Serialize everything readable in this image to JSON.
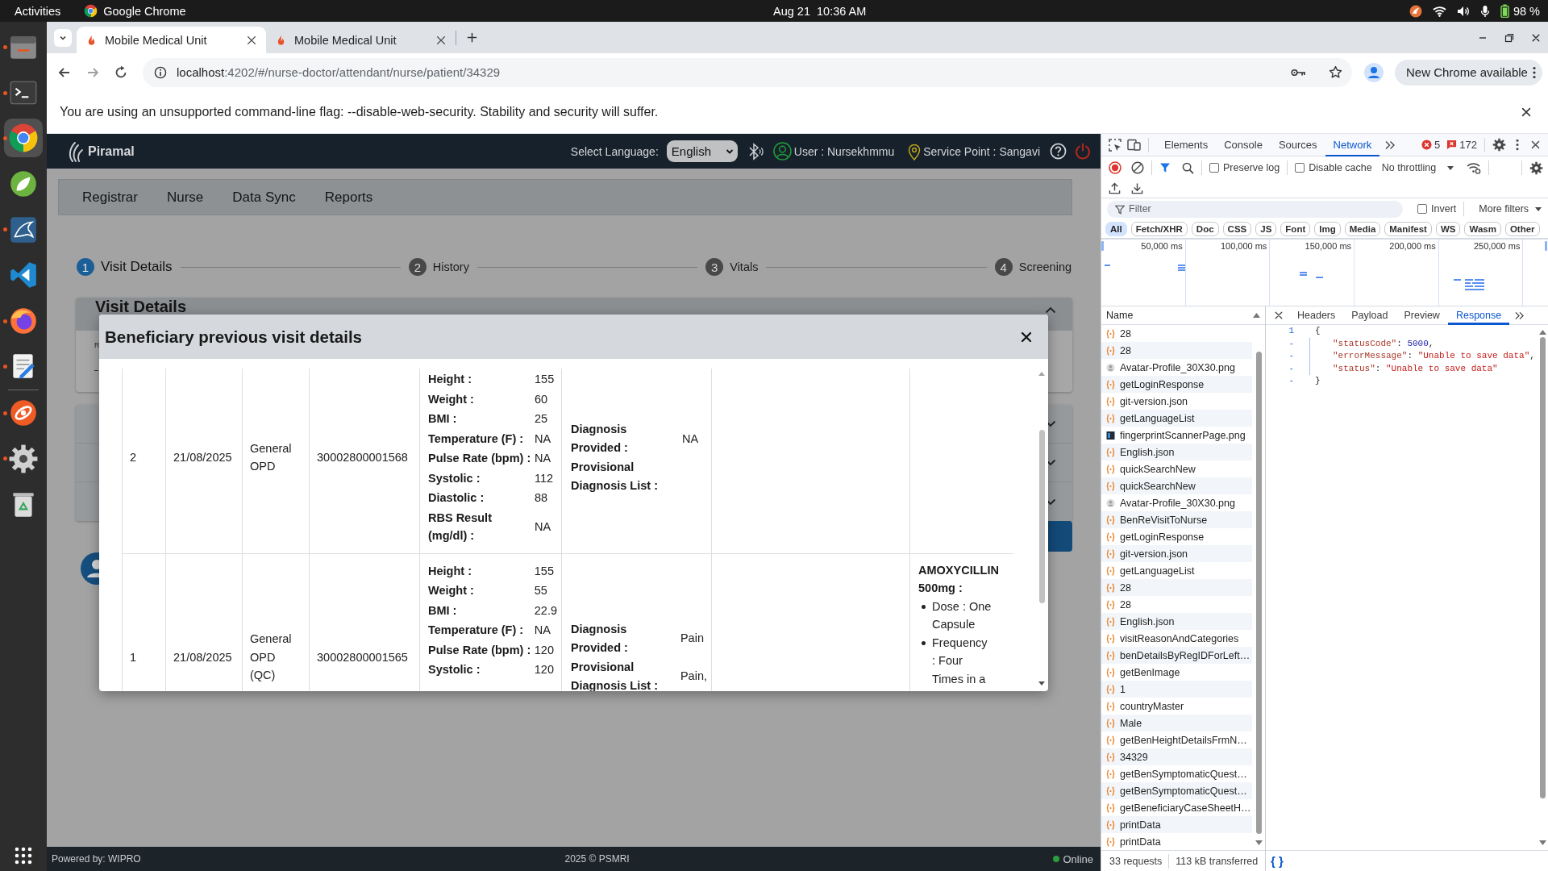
{
  "topbar": {
    "activities": "Activities",
    "app": "Google Chrome",
    "clock": "Aug 21  10:36 AM",
    "battery": "98 %"
  },
  "dock": [
    {
      "kind": "folder",
      "running": true,
      "selected": false
    },
    {
      "kind": "terminal",
      "running": true,
      "selected": false
    },
    {
      "kind": "browser",
      "running": true,
      "selected": true
    },
    {
      "kind": "leaf",
      "running": false,
      "selected": false
    },
    {
      "kind": "fin",
      "running": true,
      "selected": false
    },
    {
      "kind": "code",
      "running": false,
      "selected": false
    },
    {
      "kind": "orb",
      "running": true,
      "selected": false
    },
    {
      "kind": "notepad",
      "running": true,
      "selected": false
    },
    {
      "kind": "orbit",
      "running": true,
      "selected": false
    },
    {
      "kind": "gear",
      "running": true,
      "selected": false
    },
    {
      "kind": "trash",
      "running": false,
      "selected": false
    }
  ],
  "browser": {
    "tabs": [
      {
        "title": "Mobile Medical Unit",
        "selected": true
      },
      {
        "title": "Mobile Medical Unit",
        "selected": false
      }
    ],
    "url_host": "localhost",
    "url_path": ":4202/#/nurse-doctor/attendant/nurse/patient/34329",
    "update": "New Chrome available",
    "infobar": "You are using an unsupported command-line flag: --disable-web-security. Stability and security will suffer."
  },
  "app": {
    "brand": "Piramal",
    "language_label": "Select Language:",
    "language": "English",
    "user": "User : Nursekhmmu",
    "service_point": "Service Point : Sangavi",
    "nav": [
      "Registrar",
      "Nurse",
      "Data Sync",
      "Reports"
    ],
    "steps": [
      {
        "number": "1",
        "label": "Visit Details",
        "selected": true
      },
      {
        "number": "2",
        "label": "History",
        "selected": false
      },
      {
        "number": "3",
        "label": "Vitals",
        "selected": false
      },
      {
        "number": "4",
        "label": "Screening",
        "selected": false
      }
    ],
    "card": {
      "title": "Visit Details",
      "field_label": "R",
      "expanded": true
    },
    "sections": [
      {
        "expanded": false
      },
      {
        "expanded": false
      },
      {
        "expanded": false
      }
    ],
    "footer": {
      "powered_by": "Powered by: WIPRO",
      "copyright": "2025 © PSMRI",
      "status": "Online",
      "online": true
    }
  },
  "modal": {
    "title": "Beneficiary previous visit details",
    "rows": [
      {
        "number": "2",
        "date": "21/08/2025",
        "visit_category": "General OPD",
        "visit_code": "30002800001568",
        "vitals": [
          {
            "label": "Height :",
            "value": "155"
          },
          {
            "label": "Weight :",
            "value": "60"
          },
          {
            "label": "BMI :",
            "value": "25"
          },
          {
            "label": "Temperature (F) :",
            "value": "NA"
          },
          {
            "label": "Pulse Rate (bpm) :",
            "value": "NA"
          },
          {
            "label": "Systolic :",
            "value": "112"
          },
          {
            "label": "Diastolic :",
            "value": "88"
          },
          {
            "label": "RBS Result (mg/dl) :",
            "value": "NA"
          }
        ],
        "diagnosis": [
          {
            "label": "Diagnosis Provided :",
            "value": "NA"
          },
          {
            "label": "Provisional Diagnosis List :"
          }
        ]
      },
      {
        "number": "1",
        "date": "21/08/2025",
        "visit_category": "General OPD (QC)",
        "visit_code": "30002800001565",
        "vitals": [
          {
            "label": "Height :",
            "value": "155"
          },
          {
            "label": "Weight :",
            "value": "55"
          },
          {
            "label": "BMI :",
            "value": "22.9"
          },
          {
            "label": "Temperature (F) :",
            "value": "NA"
          },
          {
            "label": "Pulse Rate (bpm) :",
            "value": "120"
          },
          {
            "label": "Systolic :",
            "value": "120"
          }
        ],
        "diagnosis": [
          {
            "label": "Diagnosis Provided :",
            "value": "Pain"
          },
          {
            "label": "Provisional Diagnosis List :",
            "value": "Pain,"
          }
        ],
        "medicines": [
          {
            "name": "AMOXYCILLIN 500mg :",
            "details": [
              "Dose : One Capsule",
              "Frequency : Four Times in a"
            ]
          }
        ]
      }
    ]
  },
  "devtools": {
    "panel_tabs": [
      {
        "label": "Elements",
        "selected": false
      },
      {
        "label": "Console",
        "selected": false
      },
      {
        "label": "Sources",
        "selected": false
      },
      {
        "label": "Network",
        "selected": true
      }
    ],
    "errors": "5",
    "issues": "172",
    "preserve_log": {
      "label": "Preserve log",
      "checked": false
    },
    "disable_cache": {
      "label": "Disable cache",
      "checked": false
    },
    "throttling": "No throttling",
    "filter_placeholder": "Filter",
    "invert": {
      "label": "Invert",
      "checked": false
    },
    "more_filters": "More filters",
    "type_filters": [
      {
        "label": "All",
        "selected": true
      },
      {
        "label": "Fetch/XHR",
        "selected": false
      },
      {
        "label": "Doc",
        "selected": false
      },
      {
        "label": "CSS",
        "selected": false
      },
      {
        "label": "JS",
        "selected": false
      },
      {
        "label": "Font",
        "selected": false
      },
      {
        "label": "Img",
        "selected": false
      },
      {
        "label": "Media",
        "selected": false
      },
      {
        "label": "Manifest",
        "selected": false
      },
      {
        "label": "WS",
        "selected": false
      },
      {
        "label": "Wasm",
        "selected": false
      },
      {
        "label": "Other",
        "selected": false
      }
    ],
    "timeline_ticks": [
      "50,000 ms",
      "100,000 ms",
      "150,000 ms",
      "200,000 ms",
      "250,000 ms"
    ],
    "name_header": "Name",
    "requests": [
      {
        "name": "28",
        "kind": "xhr"
      },
      {
        "name": "28",
        "kind": "xhr"
      },
      {
        "name": "Avatar-Profile_30X30.png",
        "kind": "avatar"
      },
      {
        "name": "getLoginResponse",
        "kind": "xhr"
      },
      {
        "name": "git-version.json",
        "kind": "xhr"
      },
      {
        "name": "getLanguageList",
        "kind": "xhr"
      },
      {
        "name": "fingerprintScannerPage.png",
        "kind": "image"
      },
      {
        "name": "English.json",
        "kind": "xhr"
      },
      {
        "name": "quickSearchNew",
        "kind": "xhr"
      },
      {
        "name": "quickSearchNew",
        "kind": "xhr"
      },
      {
        "name": "Avatar-Profile_30X30.png",
        "kind": "avatar"
      },
      {
        "name": "BenReVisitToNurse",
        "kind": "xhr"
      },
      {
        "name": "getLoginResponse",
        "kind": "xhr"
      },
      {
        "name": "git-version.json",
        "kind": "xhr"
      },
      {
        "name": "getLanguageList",
        "kind": "xhr"
      },
      {
        "name": "28",
        "kind": "xhr"
      },
      {
        "name": "28",
        "kind": "xhr"
      },
      {
        "name": "English.json",
        "kind": "xhr"
      },
      {
        "name": "visitReasonAndCategories",
        "kind": "xhr"
      },
      {
        "name": "benDetailsByRegIDForLeft…",
        "kind": "xhr"
      },
      {
        "name": "getBenImage",
        "kind": "xhr"
      },
      {
        "name": "1",
        "kind": "xhr"
      },
      {
        "name": "countryMaster",
        "kind": "xhr"
      },
      {
        "name": "Male",
        "kind": "xhr"
      },
      {
        "name": "getBenHeightDetailsFrmN…",
        "kind": "xhr"
      },
      {
        "name": "34329",
        "kind": "xhr"
      },
      {
        "name": "getBenSymptomaticQuest…",
        "kind": "xhr"
      },
      {
        "name": "getBenSymptomaticQuest…",
        "kind": "xhr"
      },
      {
        "name": "getBeneficiaryCaseSheetH…",
        "kind": "xhr"
      },
      {
        "name": "printData",
        "kind": "xhr"
      },
      {
        "name": "printData",
        "kind": "xhr"
      }
    ],
    "detail_tabs": [
      {
        "label": "Headers",
        "selected": false
      },
      {
        "label": "Payload",
        "selected": false
      },
      {
        "label": "Preview",
        "selected": false
      },
      {
        "label": "Response",
        "selected": true
      }
    ],
    "response": [
      {
        "gutter": "1",
        "tokens": [
          {
            "kind": "punct",
            "text": "{"
          }
        ],
        "children": [
          {
            "gutter": "-",
            "tokens": [
              {
                "kind": "key",
                "text": "\"statusCode\""
              },
              {
                "kind": "punct",
                "text": ": "
              },
              {
                "kind": "number",
                "text": "5000"
              },
              {
                "kind": "punct",
                "text": ","
              }
            ]
          },
          {
            "gutter": "-",
            "tokens": [
              {
                "kind": "key",
                "text": "\"errorMessage\""
              },
              {
                "kind": "punct",
                "text": ": "
              },
              {
                "kind": "string",
                "text": "\"Unable to save data\""
              },
              {
                "kind": "punct",
                "text": ","
              }
            ]
          },
          {
            "gutter": "-",
            "tokens": [
              {
                "kind": "key",
                "text": "\"status\""
              },
              {
                "kind": "punct",
                "text": ": "
              },
              {
                "kind": "string",
                "text": "\"Unable to save data\""
              }
            ]
          }
        ]
      },
      {
        "gutter": "-",
        "tokens": [
          {
            "kind": "punct",
            "text": "}"
          }
        ]
      }
    ],
    "summary": {
      "requests": "33 requests",
      "transferred": "113 kB transferred"
    },
    "pretty_print": "{ }"
  }
}
